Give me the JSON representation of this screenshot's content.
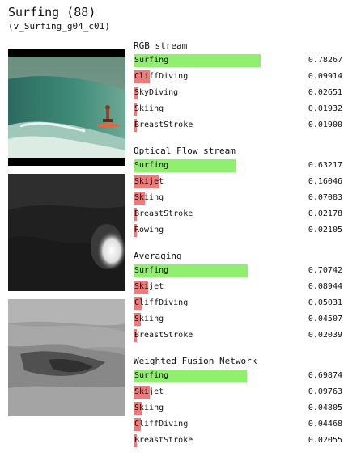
{
  "header": {
    "title": "Surfing (88)",
    "subtitle": "(v_Surfing_g04_c01)"
  },
  "colors": {
    "top_bar": "#90ef6e",
    "other_bar": "#f07a7a"
  },
  "images": [
    {
      "name": "rgb-frame-image"
    },
    {
      "name": "optical-flow-x-image"
    },
    {
      "name": "optical-flow-y-image"
    }
  ],
  "sections": [
    {
      "title": "RGB stream",
      "rows": [
        {
          "label": "Surfing",
          "value": "0.78267",
          "fraction": 0.78267
        },
        {
          "label": "CliffDiving",
          "value": "0.09914",
          "fraction": 0.09914
        },
        {
          "label": "SkyDiving",
          "value": "0.02651",
          "fraction": 0.02651
        },
        {
          "label": "Skiing",
          "value": "0.01932",
          "fraction": 0.01932
        },
        {
          "label": "BreastStroke",
          "value": "0.01900",
          "fraction": 0.019
        }
      ]
    },
    {
      "title": "Optical Flow stream",
      "rows": [
        {
          "label": "Surfing",
          "value": "0.63217",
          "fraction": 0.63217
        },
        {
          "label": "Skijet",
          "value": "0.16046",
          "fraction": 0.16046
        },
        {
          "label": "Skiing",
          "value": "0.07083",
          "fraction": 0.07083
        },
        {
          "label": "BreastStroke",
          "value": "0.02178",
          "fraction": 0.02178
        },
        {
          "label": "Rowing",
          "value": "0.02105",
          "fraction": 0.02105
        }
      ]
    },
    {
      "title": "Averaging",
      "rows": [
        {
          "label": "Surfing",
          "value": "0.70742",
          "fraction": 0.70742
        },
        {
          "label": "Skijet",
          "value": "0.08944",
          "fraction": 0.08944
        },
        {
          "label": "CliffDiving",
          "value": "0.05031",
          "fraction": 0.05031
        },
        {
          "label": "Skiing",
          "value": "0.04507",
          "fraction": 0.04507
        },
        {
          "label": "BreastStroke",
          "value": "0.02039",
          "fraction": 0.02039
        }
      ]
    },
    {
      "title": "Weighted Fusion Network",
      "rows": [
        {
          "label": "Surfing",
          "value": "0.69874",
          "fraction": 0.69874
        },
        {
          "label": "Skijet",
          "value": "0.09763",
          "fraction": 0.09763
        },
        {
          "label": "Skiing",
          "value": "0.04805",
          "fraction": 0.04805
        },
        {
          "label": "CliffDiving",
          "value": "0.04468",
          "fraction": 0.04468
        },
        {
          "label": "BreastStroke",
          "value": "0.02055",
          "fraction": 0.02055
        }
      ]
    }
  ]
}
